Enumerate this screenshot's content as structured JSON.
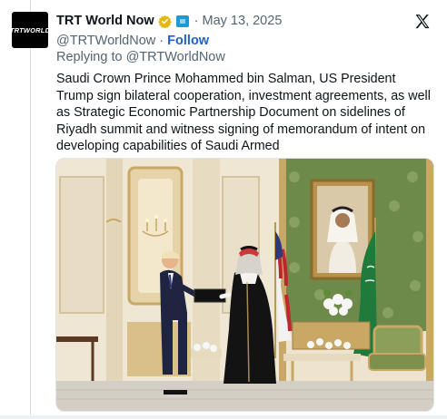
{
  "tweet": {
    "avatar_text": "TRTWORLD",
    "author_name": "TRT World Now",
    "separator": "·",
    "date": "May 13, 2025",
    "handle": "@TRTWorldNow",
    "follow_separator": "·",
    "follow_label": "Follow",
    "replying_to": "Replying to @TRTWorldNow",
    "text": "Saudi Crown Prince Mohammed bin Salman, US President Trump sign bilateral cooperation, investment agreements, as well as Strategic Economic Partnership Document on sidelines of Riyadh summit and witness signing of memorandum of intent on developing capabilities of Saudi Armed"
  },
  "colors": {
    "link_blue": "#1d62c9",
    "verified_gold": "#e2b719",
    "secondary_text": "#536471"
  },
  "icons": {
    "verified": "verified-badge-icon",
    "flag": "country-flag-icon",
    "platform": "x-logo-icon"
  }
}
